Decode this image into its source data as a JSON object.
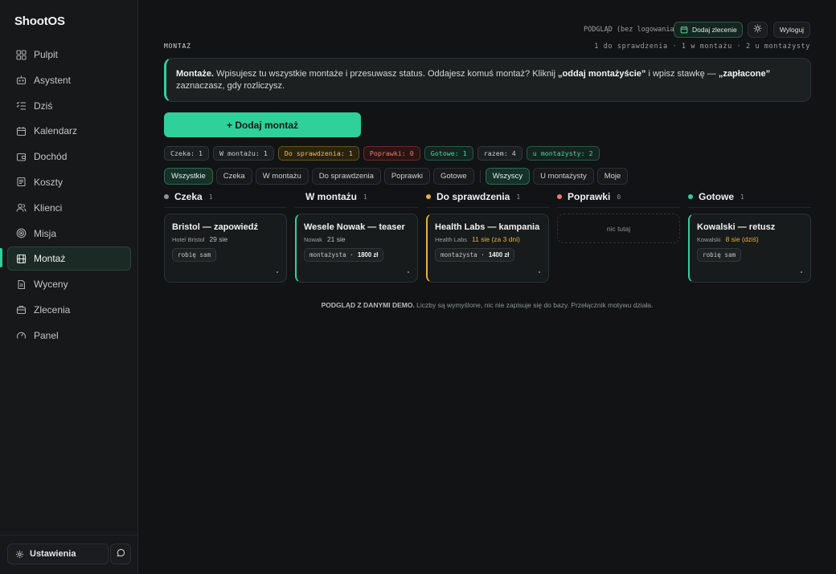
{
  "app": {
    "name": "ShootOS"
  },
  "sidebar": {
    "items": [
      {
        "label": "Pulpit",
        "icon": "grid-icon"
      },
      {
        "label": "Asystent",
        "icon": "bot-icon"
      },
      {
        "label": "Dziś",
        "icon": "checklist-icon"
      },
      {
        "label": "Kalendarz",
        "icon": "calendar-icon"
      },
      {
        "label": "Dochód",
        "icon": "wallet-icon"
      },
      {
        "label": "Koszty",
        "icon": "receipt-icon"
      },
      {
        "label": "Klienci",
        "icon": "users-icon"
      },
      {
        "label": "Misja",
        "icon": "target-icon"
      },
      {
        "label": "Montaż",
        "icon": "film-icon",
        "active": true
      },
      {
        "label": "Wyceny",
        "icon": "document-icon"
      },
      {
        "label": "Zlecenia",
        "icon": "briefcase-icon"
      },
      {
        "label": "Panel",
        "icon": "gauge-icon"
      }
    ],
    "settings_label": "Ustawienia"
  },
  "topbar": {
    "preview_label": "PODGLĄD (bez logowania)",
    "add_order_label": "Dodaj zlecenie",
    "logout_label": "Wyloguj"
  },
  "header": {
    "section_label": "MONTAŻ",
    "summary": "1 do sprawdzenia · 1 w montażu · 2 u montażysty"
  },
  "info": {
    "title": "Montaże.",
    "text1": " Wpisujesz tu wszystkie montaże i przesuwasz status. Oddajesz komuś montaż? Kliknij ",
    "bold1": "„oddaj montażyście”",
    "text2": " i wpisz stawkę — ",
    "bold2": "„zapłacone”",
    "text3": " zaznaczasz, gdy rozliczysz."
  },
  "add_button": "+ Dodaj montaż",
  "stats": [
    {
      "label": "Czeka: 1",
      "tone": "neutral"
    },
    {
      "label": "W montażu: 1",
      "tone": "neutral"
    },
    {
      "label": "Do sprawdzenia: 1",
      "tone": "yellow"
    },
    {
      "label": "Poprawki: 0",
      "tone": "red"
    },
    {
      "label": "Gotowe: 1",
      "tone": "green"
    },
    {
      "label": "razem: 4",
      "tone": "neutral"
    },
    {
      "label": "u montażysty: 2",
      "tone": "green"
    }
  ],
  "filters": {
    "status": [
      "Wszystkie",
      "Czeka",
      "W montażu",
      "Do sprawdzenia",
      "Poprawki",
      "Gotowe"
    ],
    "owner": [
      "Wszyscy",
      "U montażysty",
      "Moje"
    ]
  },
  "columns": [
    {
      "title": "Czeka",
      "count": "1",
      "dot_color": "#8f9592",
      "card": {
        "title": "Bristol — zapowiedź",
        "client": "Hotel Bristol",
        "size": "29 sie",
        "warn": false,
        "tag": "robię sam",
        "rate": null,
        "accent": "none"
      }
    },
    {
      "title": "W montażu",
      "count": "1",
      "dot_color": null,
      "card": {
        "title": "Wesele Nowak — teaser",
        "client": "Nowak",
        "size": "21 sie",
        "warn": false,
        "tag": "montażysta ·",
        "rate": "1800 zł",
        "accent": "green"
      }
    },
    {
      "title": "Do sprawdzenia",
      "count": "1",
      "dot_color": "#e3b23c",
      "card": {
        "title": "Health Labs — kampania",
        "client": "Health Labs",
        "size": "11 sie (za 3 dni)",
        "warn": true,
        "tag": "montażysta ·",
        "rate": "1400 zł",
        "accent": "yellow"
      }
    },
    {
      "title": "Poprawki",
      "count": "0",
      "dot_color": "#f07a6e",
      "empty_label": "nic tutaj"
    },
    {
      "title": "Gotowe",
      "count": "1",
      "dot_color": "#2fd09a",
      "card": {
        "title": "Kowalski — retusz",
        "client": "Kowalski",
        "size": "8 sie (dziś)",
        "warn": true,
        "tag": "robię sam",
        "rate": null,
        "accent": "green"
      }
    }
  ],
  "footer": {
    "bold": "PODGLĄD Z DANYMI DEMO.",
    "text": " Liczby są wymyślone, nic nie zapisuje się do bazy. Przełącznik motywu działa."
  }
}
